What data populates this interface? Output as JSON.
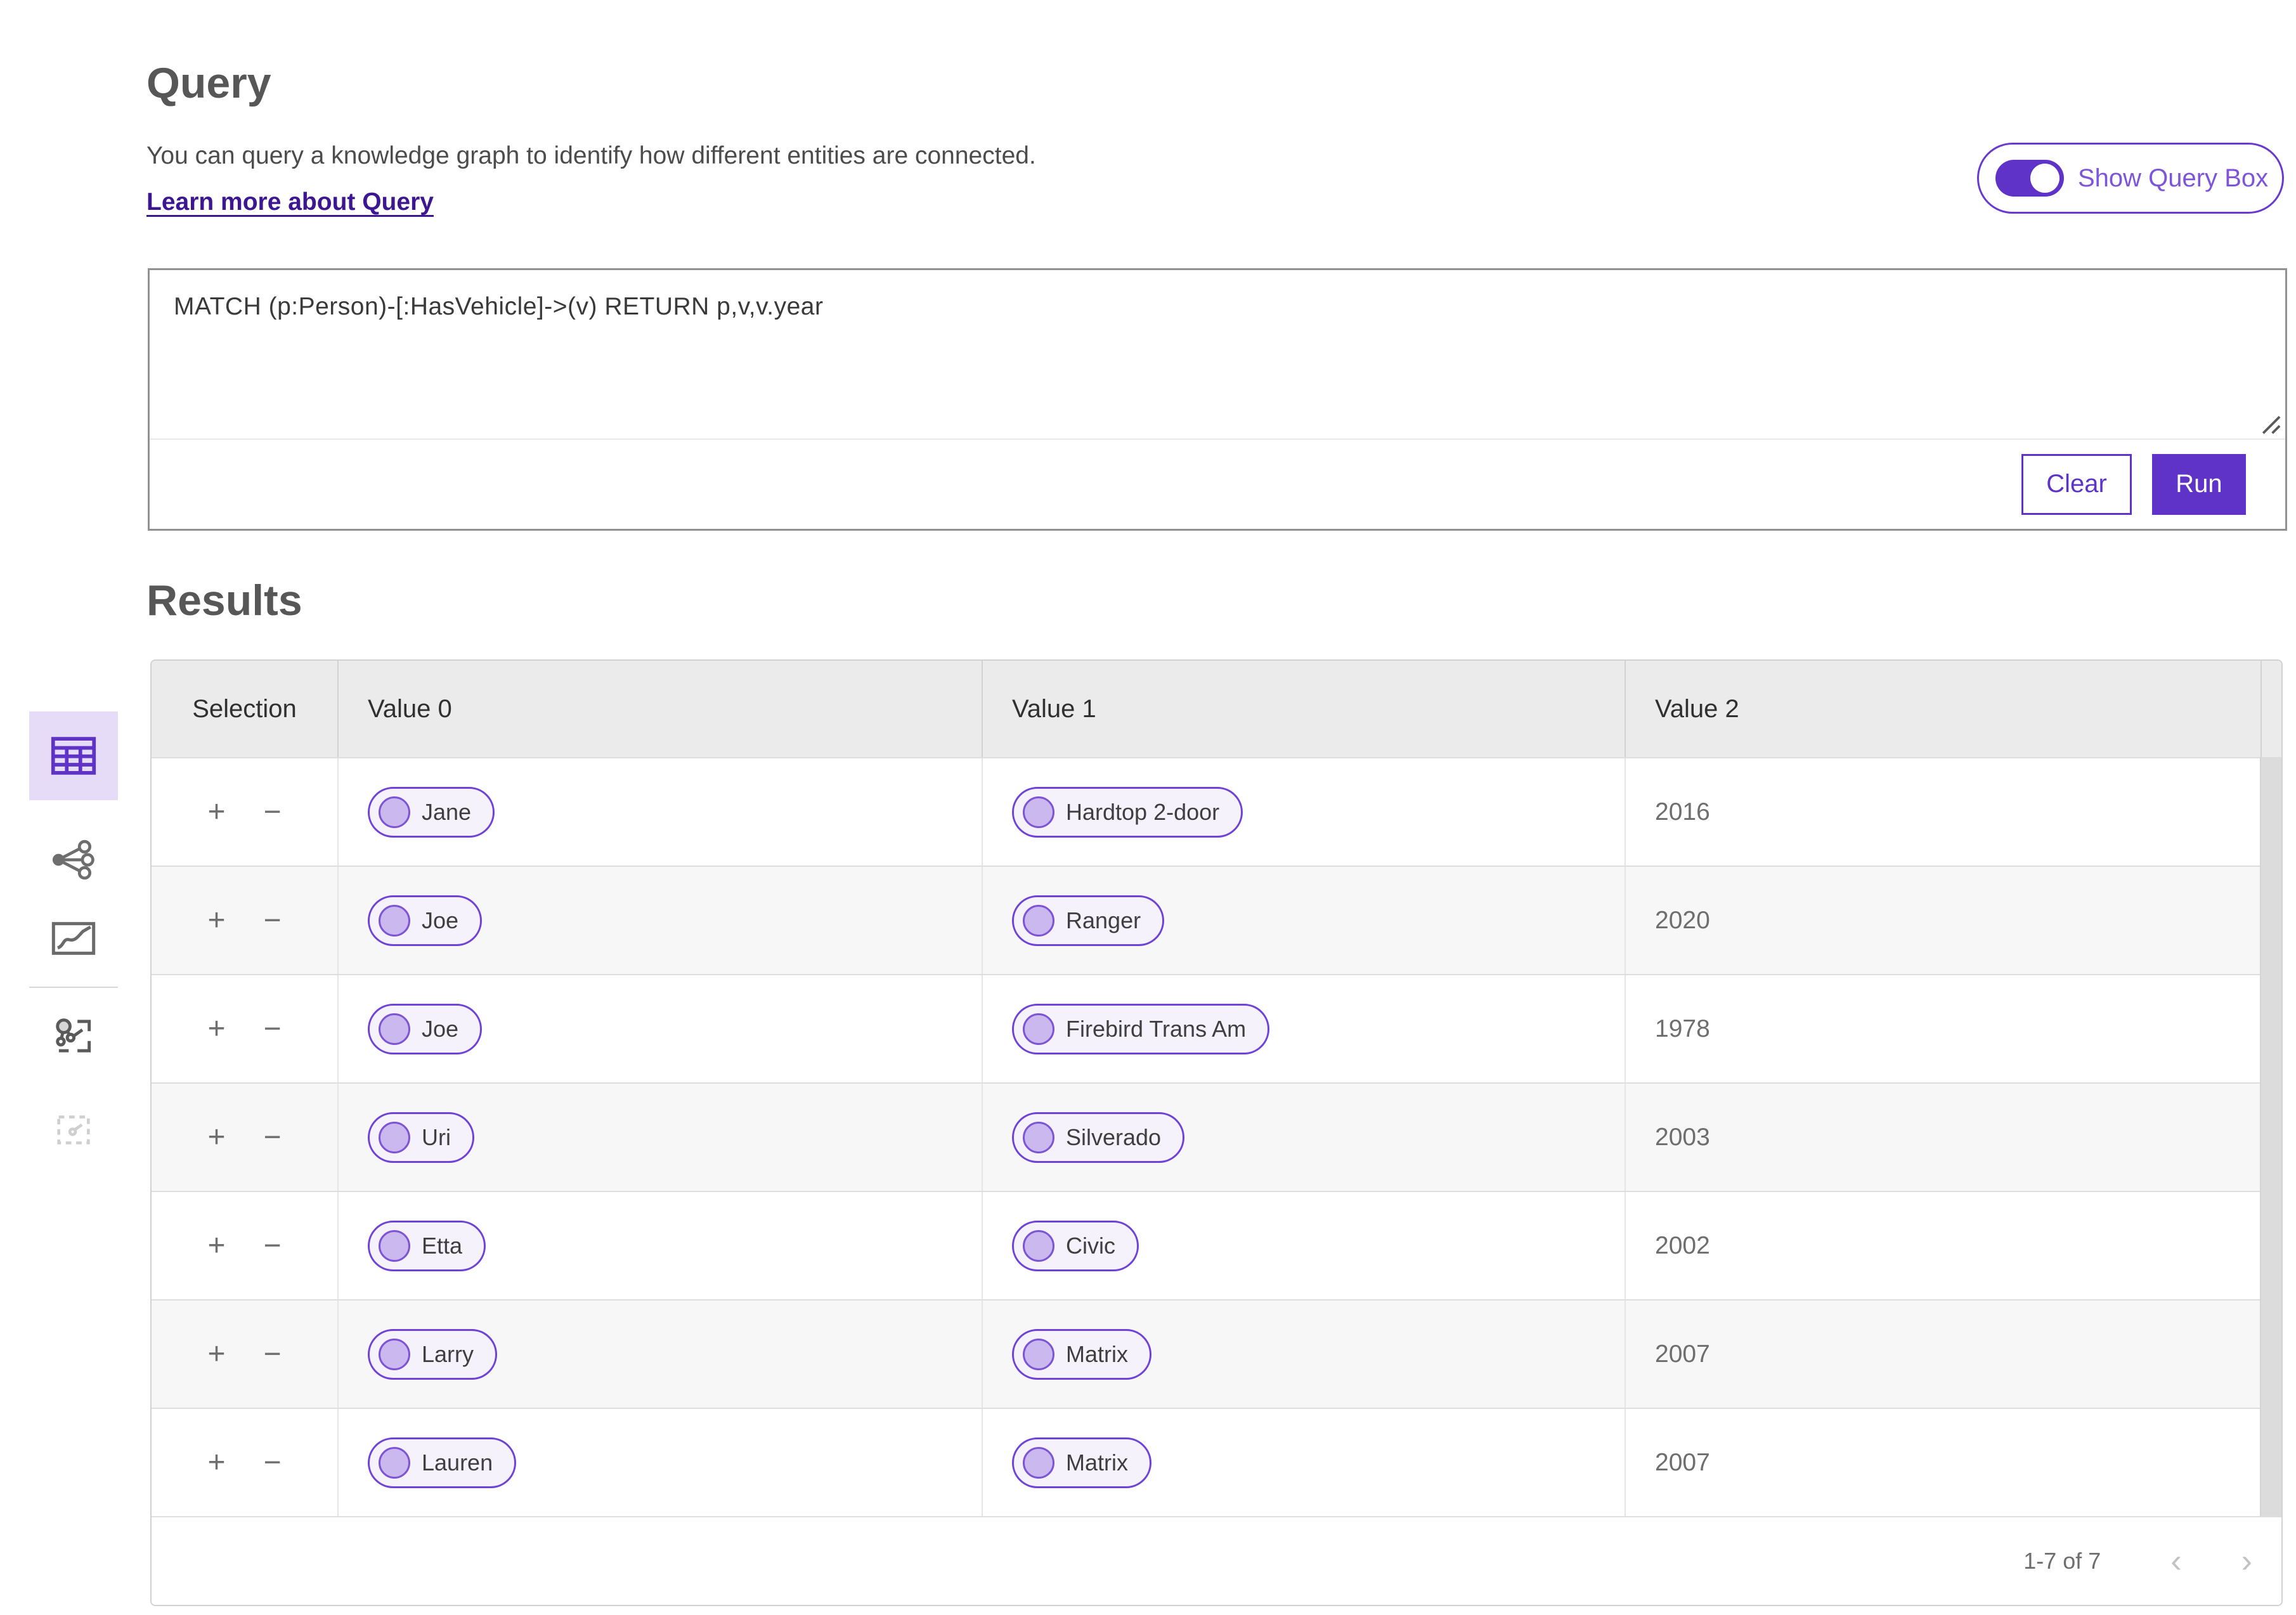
{
  "query_panel": {
    "title": "Query",
    "description": "You can query a knowledge graph to identify how different entities are connected.",
    "learn_more": "Learn more about Query",
    "toggle_label": "Show Query Box",
    "toggle_state": "on",
    "query_text": "MATCH (p:Person)-[:HasVehicle]->(v) RETURN p,v,v.year",
    "buttons": {
      "clear": "Clear",
      "run": "Run"
    }
  },
  "results_panel": {
    "title": "Results",
    "columns": [
      "Selection",
      "Value 0",
      "Value 1",
      "Value 2"
    ],
    "selection_controls": {
      "add": "+",
      "remove": "−"
    },
    "rows": [
      {
        "value0": "Jane",
        "value1": "Hardtop 2-door",
        "value2": "2016"
      },
      {
        "value0": "Joe",
        "value1": "Ranger",
        "value2": "2020"
      },
      {
        "value0": "Joe",
        "value1": "Firebird Trans Am",
        "value2": "1978"
      },
      {
        "value0": "Uri",
        "value1": "Silverado",
        "value2": "2003"
      },
      {
        "value0": "Etta",
        "value1": "Civic",
        "value2": "2002"
      },
      {
        "value0": "Larry",
        "value1": "Matrix",
        "value2": "2007"
      },
      {
        "value0": "Lauren",
        "value1": "Matrix",
        "value2": "2007"
      }
    ],
    "pagination": {
      "range": "1-7 of 7",
      "prev_icon": "‹",
      "next_icon": "›"
    }
  },
  "view_sidebar": {
    "items": [
      {
        "icon": "table-view-icon",
        "selected": true,
        "disabled": false
      },
      {
        "icon": "link-chart-view-icon",
        "selected": false,
        "disabled": false
      },
      {
        "icon": "map-view-icon",
        "selected": false,
        "disabled": false
      },
      {
        "icon": "add-to-link-chart-icon",
        "selected": false,
        "disabled": false
      },
      {
        "icon": "add-to-selection-icon",
        "selected": false,
        "disabled": true
      }
    ]
  },
  "colors": {
    "accent": "#5f33c7",
    "accent_light": "#e6dcf7",
    "pill_border": "#6f42d8",
    "pill_fill": "#f5f2fc",
    "node_fill": "#cab8ef",
    "node_border": "#7d54d6",
    "header_bg": "#ebebeb",
    "row_alt_bg": "#f7f7f7",
    "link": "#3d1692",
    "toggle_label": "#7e55da"
  }
}
